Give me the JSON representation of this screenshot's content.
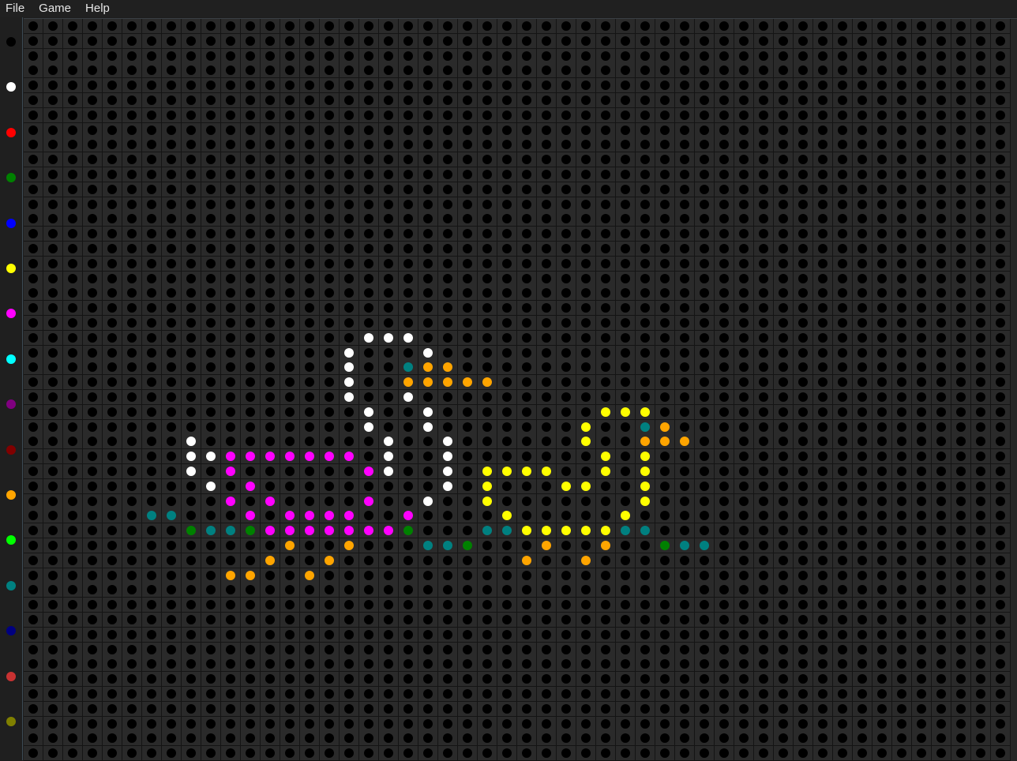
{
  "menu": {
    "items": [
      "File",
      "Game",
      "Help"
    ]
  },
  "palette": {
    "colors": [
      "#000000",
      "#ffffff",
      "#ff0000",
      "#008000",
      "#0000ff",
      "#ffff00",
      "#ff00ff",
      "#00ffff",
      "#800080",
      "#800000",
      "#ffa500",
      "#00ff00",
      "#008080",
      "#000080",
      "#c83232",
      "#808000"
    ],
    "names": [
      "black",
      "white",
      "red",
      "green",
      "blue",
      "yellow",
      "magenta",
      "cyan",
      "purple",
      "maroon",
      "orange",
      "lime",
      "teal",
      "navy",
      "brick",
      "olive"
    ]
  },
  "board": {
    "columns": 50,
    "rows": 50,
    "empty_color": "#000000",
    "pegs": [
      {
        "r": 21,
        "c": 17,
        "color": "#ffffff"
      },
      {
        "r": 21,
        "c": 18,
        "color": "#ffffff"
      },
      {
        "r": 21,
        "c": 19,
        "color": "#ffffff"
      },
      {
        "r": 22,
        "c": 16,
        "color": "#ffffff"
      },
      {
        "r": 22,
        "c": 20,
        "color": "#ffffff"
      },
      {
        "r": 23,
        "c": 16,
        "color": "#ffffff"
      },
      {
        "r": 23,
        "c": 19,
        "color": "#008080"
      },
      {
        "r": 23,
        "c": 20,
        "color": "#ffa500"
      },
      {
        "r": 23,
        "c": 21,
        "color": "#ffa500"
      },
      {
        "r": 24,
        "c": 16,
        "color": "#ffffff"
      },
      {
        "r": 24,
        "c": 19,
        "color": "#ffa500"
      },
      {
        "r": 24,
        "c": 20,
        "color": "#ffa500"
      },
      {
        "r": 24,
        "c": 21,
        "color": "#ffa500"
      },
      {
        "r": 24,
        "c": 22,
        "color": "#ffa500"
      },
      {
        "r": 24,
        "c": 23,
        "color": "#ffa500"
      },
      {
        "r": 25,
        "c": 16,
        "color": "#ffffff"
      },
      {
        "r": 25,
        "c": 19,
        "color": "#ffffff"
      },
      {
        "r": 26,
        "c": 17,
        "color": "#ffffff"
      },
      {
        "r": 26,
        "c": 20,
        "color": "#ffffff"
      },
      {
        "r": 26,
        "c": 29,
        "color": "#ffff00"
      },
      {
        "r": 26,
        "c": 30,
        "color": "#ffff00"
      },
      {
        "r": 26,
        "c": 31,
        "color": "#ffff00"
      },
      {
        "r": 27,
        "c": 17,
        "color": "#ffffff"
      },
      {
        "r": 27,
        "c": 20,
        "color": "#ffffff"
      },
      {
        "r": 27,
        "c": 28,
        "color": "#ffff00"
      },
      {
        "r": 27,
        "c": 31,
        "color": "#008080"
      },
      {
        "r": 27,
        "c": 32,
        "color": "#ffa500"
      },
      {
        "r": 28,
        "c": 8,
        "color": "#ffffff"
      },
      {
        "r": 28,
        "c": 18,
        "color": "#ffffff"
      },
      {
        "r": 28,
        "c": 21,
        "color": "#ffffff"
      },
      {
        "r": 28,
        "c": 28,
        "color": "#ffff00"
      },
      {
        "r": 28,
        "c": 31,
        "color": "#ffa500"
      },
      {
        "r": 28,
        "c": 32,
        "color": "#ffa500"
      },
      {
        "r": 28,
        "c": 33,
        "color": "#ffa500"
      },
      {
        "r": 29,
        "c": 8,
        "color": "#ffffff"
      },
      {
        "r": 29,
        "c": 9,
        "color": "#ffffff"
      },
      {
        "r": 29,
        "c": 10,
        "color": "#ff00ff"
      },
      {
        "r": 29,
        "c": 11,
        "color": "#ff00ff"
      },
      {
        "r": 29,
        "c": 12,
        "color": "#ff00ff"
      },
      {
        "r": 29,
        "c": 13,
        "color": "#ff00ff"
      },
      {
        "r": 29,
        "c": 14,
        "color": "#ff00ff"
      },
      {
        "r": 29,
        "c": 15,
        "color": "#ff00ff"
      },
      {
        "r": 29,
        "c": 16,
        "color": "#ff00ff"
      },
      {
        "r": 29,
        "c": 18,
        "color": "#ffffff"
      },
      {
        "r": 29,
        "c": 21,
        "color": "#ffffff"
      },
      {
        "r": 29,
        "c": 29,
        "color": "#ffff00"
      },
      {
        "r": 29,
        "c": 31,
        "color": "#ffff00"
      },
      {
        "r": 30,
        "c": 8,
        "color": "#ffffff"
      },
      {
        "r": 30,
        "c": 10,
        "color": "#ff00ff"
      },
      {
        "r": 30,
        "c": 17,
        "color": "#ff00ff"
      },
      {
        "r": 30,
        "c": 18,
        "color": "#ffffff"
      },
      {
        "r": 30,
        "c": 21,
        "color": "#ffffff"
      },
      {
        "r": 30,
        "c": 23,
        "color": "#ffff00"
      },
      {
        "r": 30,
        "c": 24,
        "color": "#ffff00"
      },
      {
        "r": 30,
        "c": 25,
        "color": "#ffff00"
      },
      {
        "r": 30,
        "c": 26,
        "color": "#ffff00"
      },
      {
        "r": 30,
        "c": 29,
        "color": "#ffff00"
      },
      {
        "r": 30,
        "c": 31,
        "color": "#ffff00"
      },
      {
        "r": 31,
        "c": 9,
        "color": "#ffffff"
      },
      {
        "r": 31,
        "c": 11,
        "color": "#ff00ff"
      },
      {
        "r": 31,
        "c": 21,
        "color": "#ffffff"
      },
      {
        "r": 31,
        "c": 23,
        "color": "#ffff00"
      },
      {
        "r": 31,
        "c": 27,
        "color": "#ffff00"
      },
      {
        "r": 31,
        "c": 28,
        "color": "#ffff00"
      },
      {
        "r": 31,
        "c": 31,
        "color": "#ffff00"
      },
      {
        "r": 32,
        "c": 10,
        "color": "#ff00ff"
      },
      {
        "r": 32,
        "c": 12,
        "color": "#ff00ff"
      },
      {
        "r": 32,
        "c": 17,
        "color": "#ff00ff"
      },
      {
        "r": 32,
        "c": 20,
        "color": "#ffffff"
      },
      {
        "r": 32,
        "c": 23,
        "color": "#ffff00"
      },
      {
        "r": 32,
        "c": 31,
        "color": "#ffff00"
      },
      {
        "r": 33,
        "c": 6,
        "color": "#008080"
      },
      {
        "r": 33,
        "c": 7,
        "color": "#008080"
      },
      {
        "r": 33,
        "c": 11,
        "color": "#ff00ff"
      },
      {
        "r": 33,
        "c": 13,
        "color": "#ff00ff"
      },
      {
        "r": 33,
        "c": 14,
        "color": "#ff00ff"
      },
      {
        "r": 33,
        "c": 15,
        "color": "#ff00ff"
      },
      {
        "r": 33,
        "c": 16,
        "color": "#ff00ff"
      },
      {
        "r": 33,
        "c": 19,
        "color": "#ff00ff"
      },
      {
        "r": 33,
        "c": 24,
        "color": "#ffff00"
      },
      {
        "r": 33,
        "c": 30,
        "color": "#ffff00"
      },
      {
        "r": 34,
        "c": 8,
        "color": "#008000"
      },
      {
        "r": 34,
        "c": 9,
        "color": "#008080"
      },
      {
        "r": 34,
        "c": 10,
        "color": "#008080"
      },
      {
        "r": 34,
        "c": 11,
        "color": "#008000"
      },
      {
        "r": 34,
        "c": 12,
        "color": "#ff00ff"
      },
      {
        "r": 34,
        "c": 13,
        "color": "#ff00ff"
      },
      {
        "r": 34,
        "c": 14,
        "color": "#ff00ff"
      },
      {
        "r": 34,
        "c": 15,
        "color": "#ff00ff"
      },
      {
        "r": 34,
        "c": 16,
        "color": "#ff00ff"
      },
      {
        "r": 34,
        "c": 17,
        "color": "#ff00ff"
      },
      {
        "r": 34,
        "c": 18,
        "color": "#ff00ff"
      },
      {
        "r": 34,
        "c": 19,
        "color": "#008000"
      },
      {
        "r": 34,
        "c": 23,
        "color": "#008080"
      },
      {
        "r": 34,
        "c": 24,
        "color": "#008080"
      },
      {
        "r": 34,
        "c": 25,
        "color": "#ffff00"
      },
      {
        "r": 34,
        "c": 26,
        "color": "#ffff00"
      },
      {
        "r": 34,
        "c": 27,
        "color": "#ffff00"
      },
      {
        "r": 34,
        "c": 28,
        "color": "#ffff00"
      },
      {
        "r": 34,
        "c": 29,
        "color": "#ffff00"
      },
      {
        "r": 34,
        "c": 30,
        "color": "#008080"
      },
      {
        "r": 34,
        "c": 31,
        "color": "#008080"
      },
      {
        "r": 35,
        "c": 13,
        "color": "#ffa500"
      },
      {
        "r": 35,
        "c": 16,
        "color": "#ffa500"
      },
      {
        "r": 35,
        "c": 20,
        "color": "#008080"
      },
      {
        "r": 35,
        "c": 21,
        "color": "#008080"
      },
      {
        "r": 35,
        "c": 22,
        "color": "#008000"
      },
      {
        "r": 35,
        "c": 26,
        "color": "#ffa500"
      },
      {
        "r": 35,
        "c": 29,
        "color": "#ffa500"
      },
      {
        "r": 35,
        "c": 32,
        "color": "#008000"
      },
      {
        "r": 35,
        "c": 33,
        "color": "#008080"
      },
      {
        "r": 35,
        "c": 34,
        "color": "#008080"
      },
      {
        "r": 36,
        "c": 12,
        "color": "#ffa500"
      },
      {
        "r": 36,
        "c": 15,
        "color": "#ffa500"
      },
      {
        "r": 36,
        "c": 25,
        "color": "#ffa500"
      },
      {
        "r": 36,
        "c": 28,
        "color": "#ffa500"
      },
      {
        "r": 37,
        "c": 10,
        "color": "#ffa500"
      },
      {
        "r": 37,
        "c": 11,
        "color": "#ffa500"
      },
      {
        "r": 37,
        "c": 14,
        "color": "#ffa500"
      }
    ]
  }
}
